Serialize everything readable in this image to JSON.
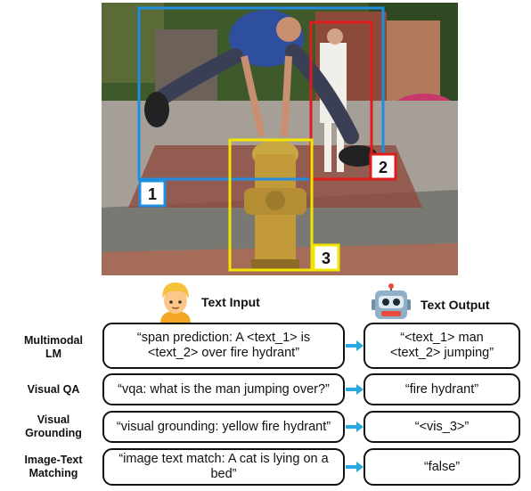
{
  "headers": {
    "input": "Text Input",
    "output": "Text Output"
  },
  "region_labels": [
    "1",
    "2",
    "3"
  ],
  "colors": {
    "region_1": "#1e8fe0",
    "region_2": "#e01b1b",
    "region_3": "#f2e500",
    "arrow": "#29a8e0"
  },
  "icons": {
    "input": "person-emoji-icon",
    "output": "robot-emoji-icon",
    "arrows": "right-arrow-icon"
  },
  "rows": [
    {
      "label": [
        "Multimodal",
        "LM"
      ],
      "input": [
        "“span prediction: A <text_1> is",
        "<text_2> over fire hydrant”"
      ],
      "output": [
        "“<text_1> man",
        "<text_2> jumping”"
      ]
    },
    {
      "label": [
        "Visual QA"
      ],
      "input": [
        "“vqa: what is the man jumping over?”"
      ],
      "output": [
        "“fire hydrant”"
      ]
    },
    {
      "label": [
        "Visual",
        "Grounding"
      ],
      "input": [
        "“visual grounding: yellow fire hydrant”"
      ],
      "output": [
        "“<vis_3>”"
      ]
    },
    {
      "label": [
        "Image-Text",
        "Matching"
      ],
      "input": [
        "“image text match: A cat is lying on a",
        "bed”"
      ],
      "output": [
        "“false”"
      ]
    }
  ]
}
